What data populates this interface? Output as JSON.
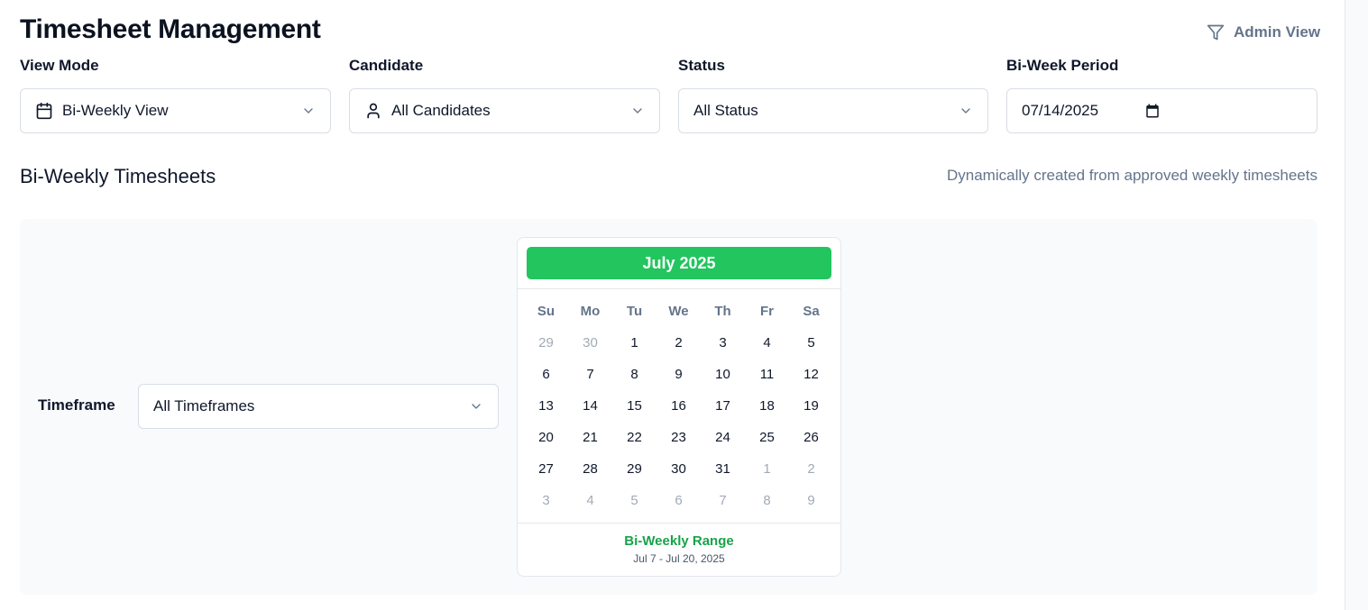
{
  "header": {
    "title": "Timesheet Management",
    "admin_view_label": "Admin View"
  },
  "filters": {
    "view_mode": {
      "label": "View Mode",
      "value": "Bi-Weekly View"
    },
    "candidate": {
      "label": "Candidate",
      "value": "All Candidates"
    },
    "status": {
      "label": "Status",
      "value": "All Status"
    },
    "bi_week_period": {
      "label": "Bi-Week Period",
      "value": "07/14/2025"
    }
  },
  "section": {
    "title": "Bi-Weekly Timesheets",
    "subtitle": "Dynamically created from approved weekly timesheets"
  },
  "timeframe": {
    "label": "Timeframe",
    "value": "All Timeframes"
  },
  "calendar": {
    "month_label": "July 2025",
    "weekdays": [
      "Su",
      "Mo",
      "Tu",
      "We",
      "Th",
      "Fr",
      "Sa"
    ],
    "weeks": [
      [
        {
          "d": "29",
          "muted": true
        },
        {
          "d": "30",
          "muted": true
        },
        {
          "d": "1"
        },
        {
          "d": "2"
        },
        {
          "d": "3"
        },
        {
          "d": "4"
        },
        {
          "d": "5"
        }
      ],
      [
        {
          "d": "6"
        },
        {
          "d": "7"
        },
        {
          "d": "8"
        },
        {
          "d": "9"
        },
        {
          "d": "10"
        },
        {
          "d": "11"
        },
        {
          "d": "12"
        }
      ],
      [
        {
          "d": "13"
        },
        {
          "d": "14"
        },
        {
          "d": "15"
        },
        {
          "d": "16"
        },
        {
          "d": "17"
        },
        {
          "d": "18"
        },
        {
          "d": "19"
        }
      ],
      [
        {
          "d": "20"
        },
        {
          "d": "21"
        },
        {
          "d": "22"
        },
        {
          "d": "23"
        },
        {
          "d": "24"
        },
        {
          "d": "25"
        },
        {
          "d": "26"
        }
      ],
      [
        {
          "d": "27"
        },
        {
          "d": "28"
        },
        {
          "d": "29"
        },
        {
          "d": "30"
        },
        {
          "d": "31"
        },
        {
          "d": "1",
          "muted": true
        },
        {
          "d": "2",
          "muted": true
        }
      ],
      [
        {
          "d": "3",
          "muted": true
        },
        {
          "d": "4",
          "muted": true
        },
        {
          "d": "5",
          "muted": true
        },
        {
          "d": "6",
          "muted": true
        },
        {
          "d": "7",
          "muted": true
        },
        {
          "d": "8",
          "muted": true
        },
        {
          "d": "9",
          "muted": true
        }
      ]
    ],
    "range_label": "Bi-Weekly Range",
    "range_value": "Jul 7 - Jul 20, 2025"
  },
  "colors": {
    "accent_green": "#22c55e",
    "range_text_green": "#16a34a",
    "muted_text": "#64748b"
  },
  "icons": {
    "admin_view": "filter-icon",
    "view_mode": "calendar-icon",
    "candidate": "user-icon",
    "dropdown": "chevron-down-icon",
    "date_picker": "calendar-icon"
  }
}
